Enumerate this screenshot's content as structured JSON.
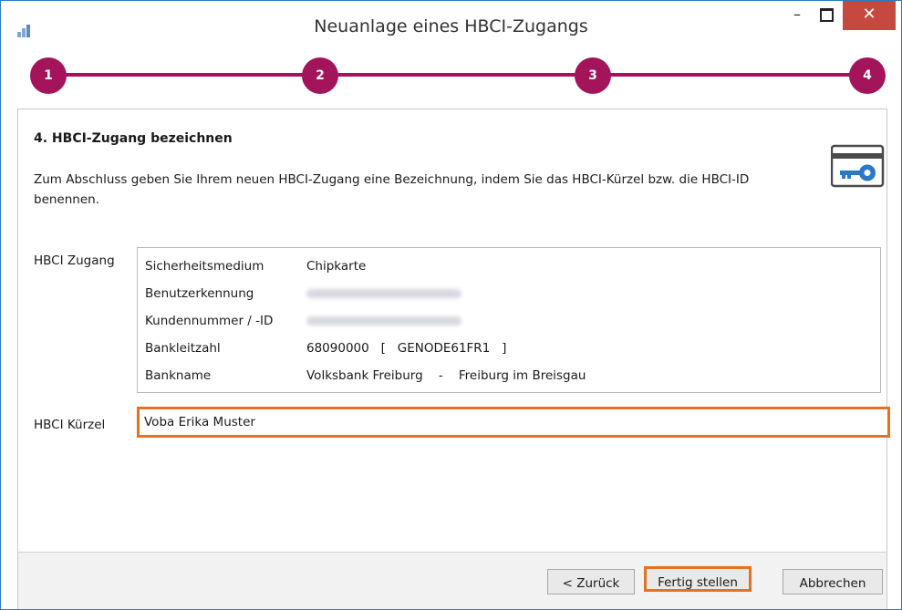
{
  "window": {
    "title": "Neuanlage eines HBCI-Zugangs",
    "minimize_glyph": "–",
    "close_glyph": "✕"
  },
  "stepper": {
    "steps": [
      "1",
      "2",
      "3",
      "4"
    ],
    "accent_color": "#a3145a"
  },
  "section": {
    "heading": "4. HBCI-Zugang bezeichnen",
    "description": "Zum Abschluss geben Sie Ihrem neuen HBCI-Zugang eine Bezeichnung, indem Sie das HBCI-Kürzel bzw. die HBCI-ID benennen.",
    "icon": "card-key-icon"
  },
  "zugang": {
    "label": "HBCI Zugang",
    "rows": [
      {
        "key": "Sicherheitsmedium",
        "value": "Chipkarte"
      },
      {
        "key": "Benutzerkennung",
        "value": ""
      },
      {
        "key": "Kundennummer / -ID",
        "value": ""
      },
      {
        "key": "Bankleitzahl",
        "value": "68090000   [   GENODE61FR1   ]"
      },
      {
        "key": "Bankname",
        "value": "Volksbank Freiburg    -    Freiburg im Breisgau"
      }
    ]
  },
  "kuerzel": {
    "label": "HBCI Kürzel",
    "value": "Voba Erika Muster",
    "highlight_color": "#e3731e"
  },
  "footer": {
    "back_label": "< Zurück",
    "finish_label": "Fertig stellen",
    "cancel_label": "Abbrechen"
  }
}
